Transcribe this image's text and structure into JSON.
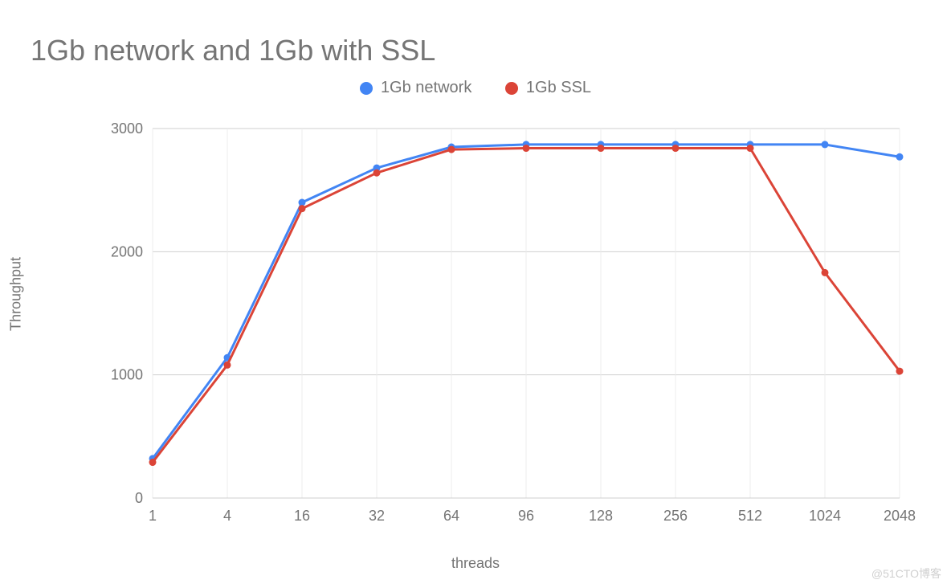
{
  "chart_data": {
    "type": "line",
    "title": "1Gb network and 1Gb with SSL",
    "xlabel": "threads",
    "ylabel": "Throughput",
    "categories": [
      "1",
      "4",
      "16",
      "32",
      "64",
      "96",
      "128",
      "256",
      "512",
      "1024",
      "2048"
    ],
    "y_ticks": [
      0,
      1000,
      2000,
      3000
    ],
    "ylim": [
      0,
      3000
    ],
    "series": [
      {
        "name": "1Gb network",
        "color": "#4285f4",
        "values": [
          320,
          1140,
          2400,
          2680,
          2850,
          2870,
          2870,
          2870,
          2870,
          2870,
          2770
        ]
      },
      {
        "name": "1Gb SSL",
        "color": "#db4437",
        "values": [
          290,
          1080,
          2350,
          2640,
          2830,
          2840,
          2840,
          2840,
          2840,
          1830,
          1030
        ]
      }
    ]
  },
  "watermark": "@51CTO博客"
}
